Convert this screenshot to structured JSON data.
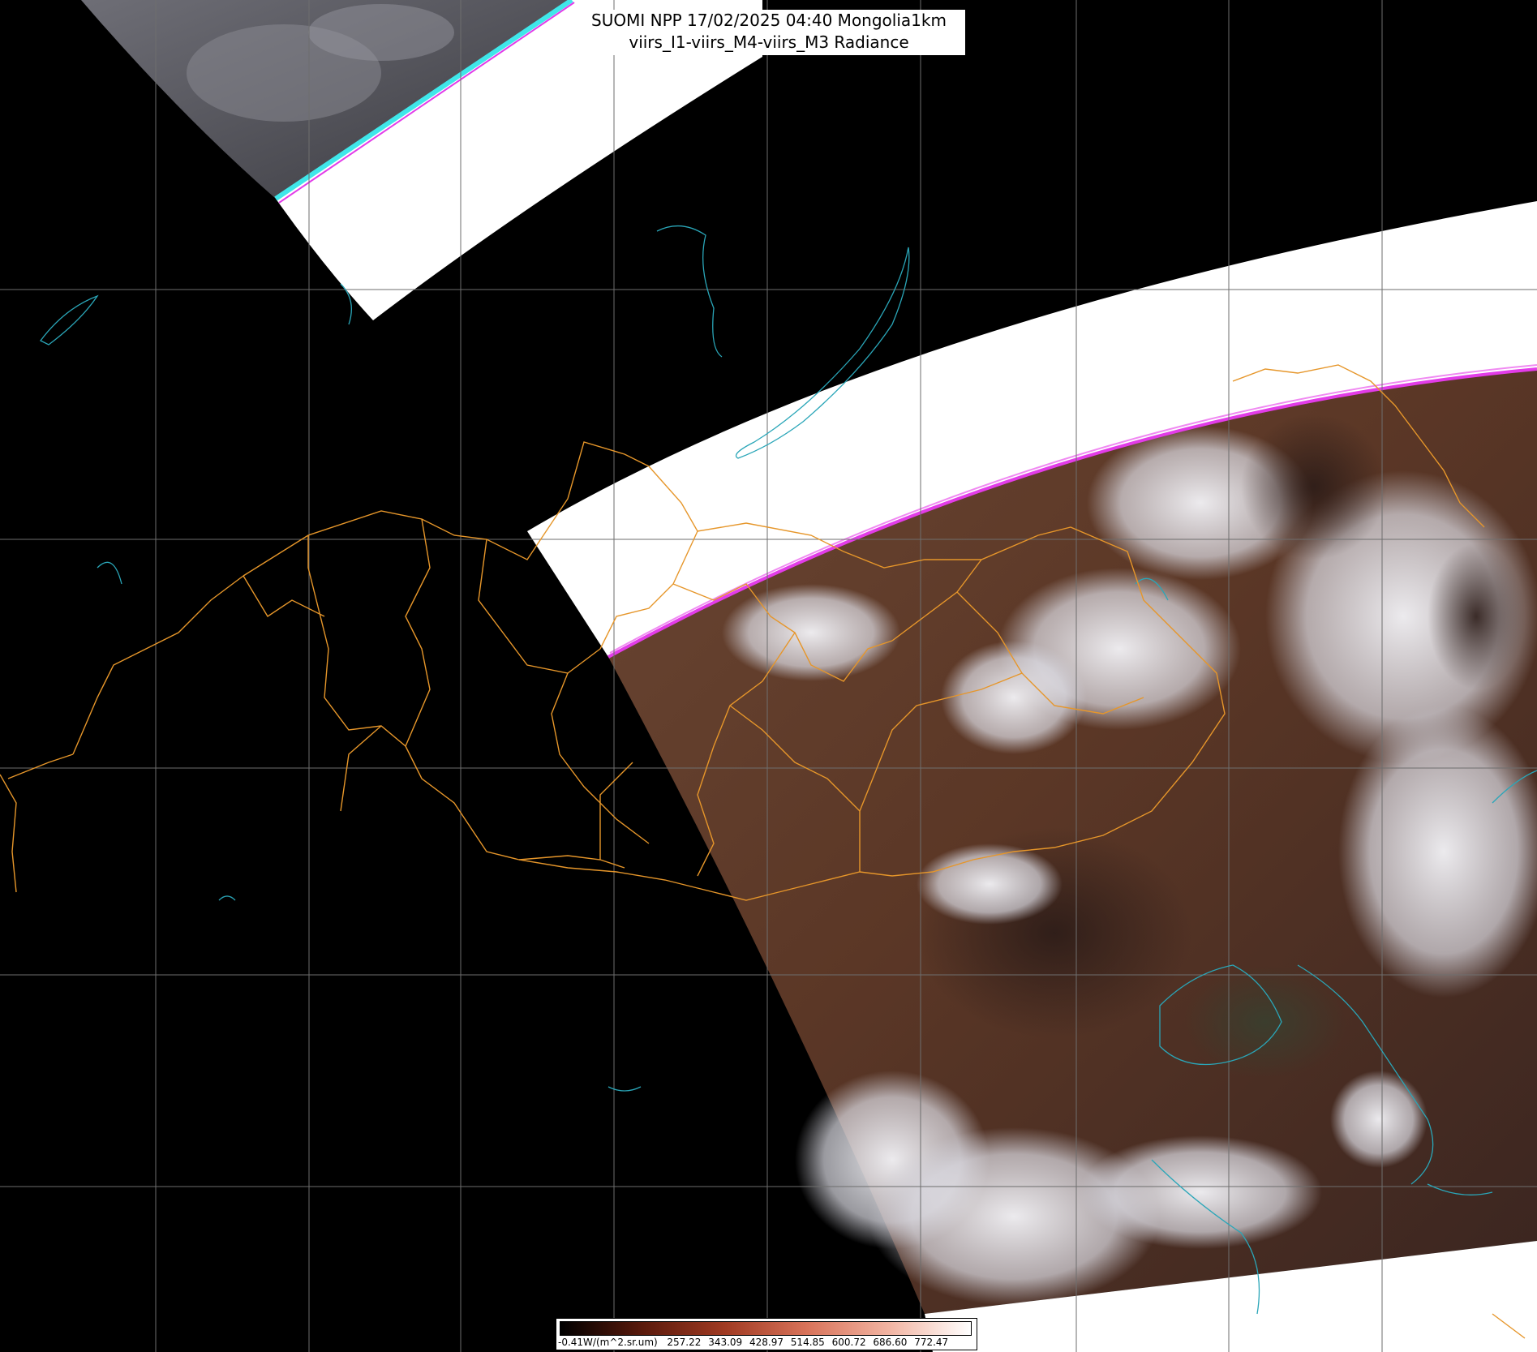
{
  "title": {
    "line1": "SUOMI NPP 17/02/2025 04:40 Mongolia1km",
    "line2": "viirs_I1-viirs_M4-viirs_M3 Radiance"
  },
  "colors": {
    "background": "#000000",
    "grid": "#6e6e6e",
    "border": "#e6962a",
    "coast": "#2aa6b8",
    "swath_edge_cyan": "#3fe7ea",
    "swath_edge_magenta": "#e23ce8",
    "no_data": "#ffffff",
    "land": "#5a3a27",
    "cloud": "#e8e8ee"
  },
  "colorbar": {
    "ticks": [
      {
        "label": "-0.41W/(m^2.sr.um)",
        "value": -0.41
      },
      {
        "label": "257.22",
        "value": 257.22
      },
      {
        "label": "343.09",
        "value": 343.09
      },
      {
        "label": "428.97",
        "value": 428.97
      },
      {
        "label": "514.85",
        "value": 514.85
      },
      {
        "label": "600.72",
        "value": 600.72
      },
      {
        "label": "686.60",
        "value": 686.6
      },
      {
        "label": "772.47",
        "value": 772.47
      }
    ],
    "min": -0.41,
    "max": 858.34,
    "stops": [
      "#000000",
      "#5a1a0c",
      "#a03a22",
      "#d8735a",
      "#f2b4a2",
      "#ffffff"
    ]
  }
}
